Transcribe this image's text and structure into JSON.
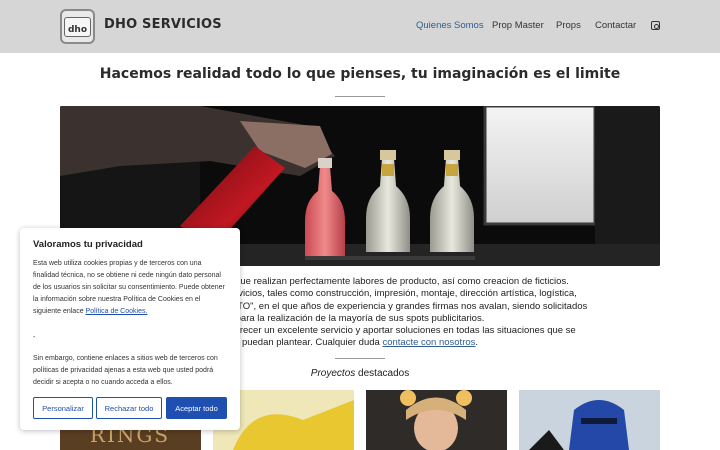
{
  "header": {
    "brand": "DHO SERVICIOS",
    "logo_text": "dho",
    "nav": [
      "Quienes Somos",
      "Prop Master",
      "Props",
      "Contactar"
    ],
    "active_nav": "Quienes Somos",
    "social_icon": "instagram-icon",
    "colors": {
      "bar": "#d6d6d6",
      "active": "#2f5e8f"
    }
  },
  "hero": {
    "headline": "Hacemos realidad todo lo que pienses, tu imaginación es el limite"
  },
  "description": {
    "line1": "mente cualificados, que realizan perfectamente labores de producto, así como creacion de ficticios.",
    "line2": "a centralización de servicios, tales como construcción, impresión, montaje, dirección artística, logística,",
    "line3": "del pastel \" EL PRODUCTO\",  en el que años de experiencia y  grandes firmas nos avalan, siendo solicitados",
    "line4": "para la realización de la mayoría de sus spots publicitarios.",
    "line5": "cación nos permiten ofrecer un excelente servicio y aportar soluciones en todas las situaciones que se",
    "line6_prefix": "puedan plantear. Cualquier duda ",
    "line6_link": "contacte con nosotros",
    "line6_suffix": "."
  },
  "projects": {
    "title_italic": "Proyectos",
    "title_rest": " destacados"
  },
  "cookie": {
    "title": "Valoramos tu privacidad",
    "p1_line1": "Esta web utiliza cookies propias y de terceros con una",
    "p1_line2": "finalidad técnica, no se obtiene ni cede ningún dato personal",
    "p1_line3": "de los usuarios sin solicitar su consentimiento. Puede obtener",
    "p1_line4": "la información sobre nuestra Política de Cookies en el",
    "p1_line5_prefix": "siguiente enlace ",
    "p1_link": "Política de Cookies.",
    "separator": "-",
    "p2_line1": "Sin embargo, contiene enlaces a sitios web de terceros con",
    "p2_line2": "políticas de privacidad ajenas a esta web que usted podrá",
    "p2_line3": "decidir si acepta o no cuando acceda a ellos.",
    "btn_customize": "Personalizar",
    "btn_reject": "Rechazar todo",
    "btn_accept": "Aceptar todo",
    "colors": {
      "accent": "#1f4fb0"
    }
  }
}
